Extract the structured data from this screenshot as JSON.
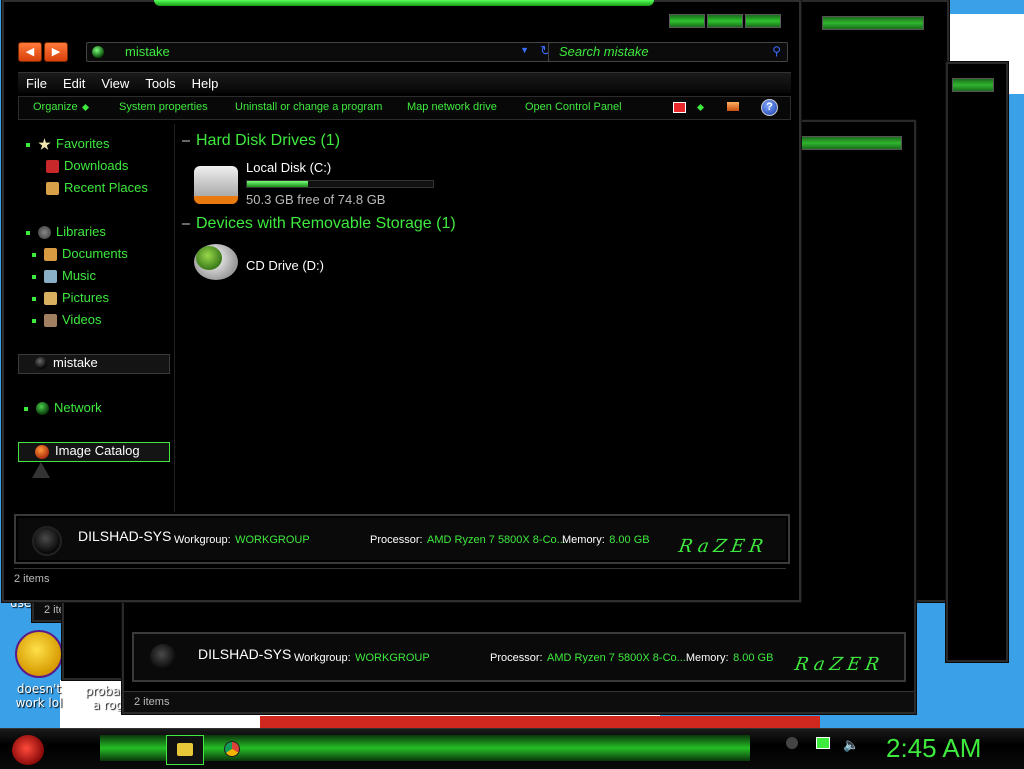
{
  "window": {
    "address_text": "mistake",
    "search_placeholder": "Search mistake",
    "menu": [
      "File",
      "Edit",
      "View",
      "Tools",
      "Help"
    ],
    "commands": [
      "Organize",
      "System properties",
      "Uninstall or change a program",
      "Map network drive",
      "Open Control Panel"
    ],
    "help_glyph": "?",
    "nav": {
      "favorites": "Favorites",
      "downloads": "Downloads",
      "recent_places": "Recent Places",
      "libraries": "Libraries",
      "documents": "Documents",
      "music": "Music",
      "pictures": "Pictures",
      "videos": "Videos",
      "computer": "mistake",
      "network": "Network",
      "image_catalog": "Image Catalog"
    },
    "groups": {
      "hard_disks": "Hard Disk Drives (1)",
      "removable": "Devices with Removable Storage (1)"
    },
    "drives": {
      "local_disk": "Local Disk (C:)",
      "local_disk_free": "50.3 GB free of 74.8 GB",
      "local_disk_used_fraction": 0.33,
      "cd_drive": "CD Drive (D:)"
    },
    "details": {
      "computer_name": "DILSHAD-SYS",
      "workgroup_label": "Workgroup:",
      "workgroup": "WORKGROUP",
      "processor_label": "Processor:",
      "processor": "AMD Ryzen 7 5800X 8-Co...",
      "memory_label": "Memory:",
      "memory": "8.00 GB",
      "brand": "RaZER"
    },
    "status": "2 items"
  },
  "desktop": {
    "icon_label_1": "doesn't work lol",
    "icon_label_2": "probabl a rog",
    "partial_text": "use"
  },
  "taskbar": {
    "clock": "2:45 AM"
  },
  "colors": {
    "accent": "#3eea3e",
    "window_bg": "#000000",
    "desktop": "#3aa0e8"
  }
}
